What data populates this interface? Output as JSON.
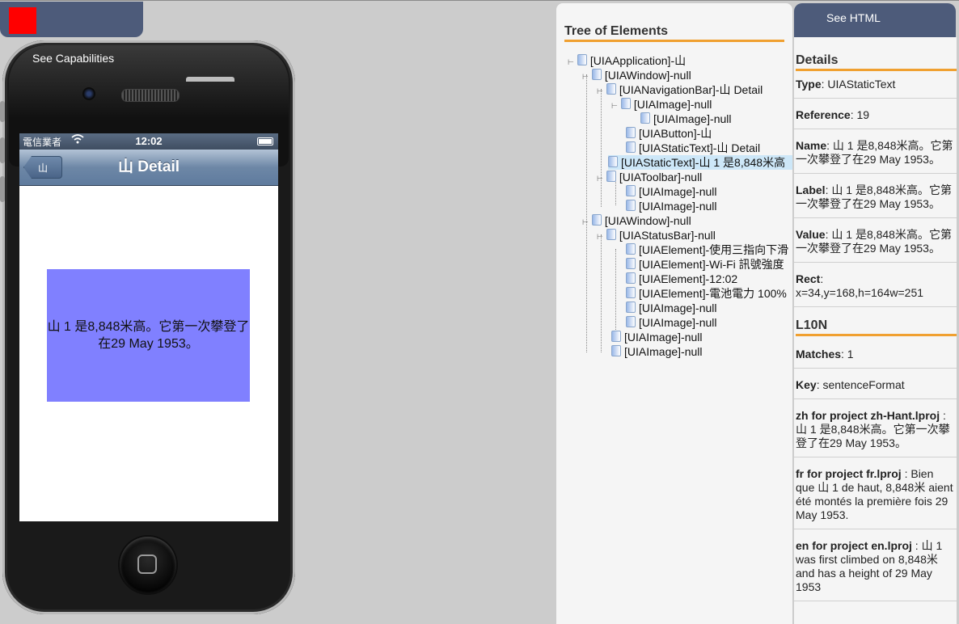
{
  "top_tab": {
    "see_capabilities": "See Capabilities"
  },
  "status_bar": {
    "carrier": "電信業者",
    "wifi": "⌔",
    "time": "12:02"
  },
  "nav_bar": {
    "back_label": "山",
    "title": "山 Detail"
  },
  "content": {
    "label_text": "山 1 是8,848米高。它第一次攀登了在29 May 1953。"
  },
  "tree_panel": {
    "title": "Tree of Elements",
    "nodes": [
      "[UIAApplication]-山",
      "[UIAWindow]-null",
      "[UIANavigationBar]-山 Detail",
      "[UIAImage]-null",
      "[UIAImage]-null",
      "[UIAButton]-山",
      "[UIAStaticText]-山 Detail",
      "[UIAStaticText]-山 1 是8,848米高",
      "[UIAToolbar]-null",
      "[UIAImage]-null",
      "[UIAImage]-null",
      "[UIAWindow]-null",
      "[UIAStatusBar]-null",
      "[UIAElement]-使用三指向下滑",
      "[UIAElement]-Wi-Fi 訊號強度",
      "[UIAElement]-12:02",
      "[UIAElement]-電池電力 100%",
      "[UIAImage]-null",
      "[UIAImage]-null",
      "[UIAImage]-null",
      "[UIAImage]-null"
    ]
  },
  "details_panel": {
    "see_html": "See HTML",
    "title": "Details",
    "type_label": "Type",
    "type_value": ": UIAStaticText",
    "reference_label": "Reference",
    "reference_value": ": 19",
    "name_label": "Name",
    "name_value": ": 山 1 是8,848米高。它第一次攀登了在29 May 1953。",
    "label_label": "Label",
    "label_value": ": 山 1 是8,848米高。它第一次攀登了在29 May 1953。",
    "value_label": "Value",
    "value_value": ": 山 1 是8,848米高。它第一次攀登了在29 May 1953。",
    "rect_label": "Rect",
    "rect_value": ":",
    "rect_text": "x=34,y=168,h=164w=251",
    "l10n_title": "L10N",
    "matches_label": "Matches",
    "matches_value": ": 1",
    "key_label": "Key",
    "key_value": ": sentenceFormat",
    "zh_label": "zh for project zh-Hant.lproj",
    "zh_value": " : 山 1 是8,848米高。它第一次攀登了在29 May 1953。",
    "fr_label": "fr for project fr.lproj",
    "fr_value": " : Bien que 山 1 de haut, 8,848米 aient été montés la première fois 29 May 1953.",
    "en_label": "en for project en.lproj",
    "en_value": " : 山 1 was first climbed on 8,848米 and has a height of 29 May 1953"
  },
  "colors": {
    "tab_bg": "#4d5b7a",
    "accent_orange": "#f0a030",
    "label_bg": "#8080ff",
    "selected_row": "#cde7f8",
    "red_square": "#ff0000"
  }
}
